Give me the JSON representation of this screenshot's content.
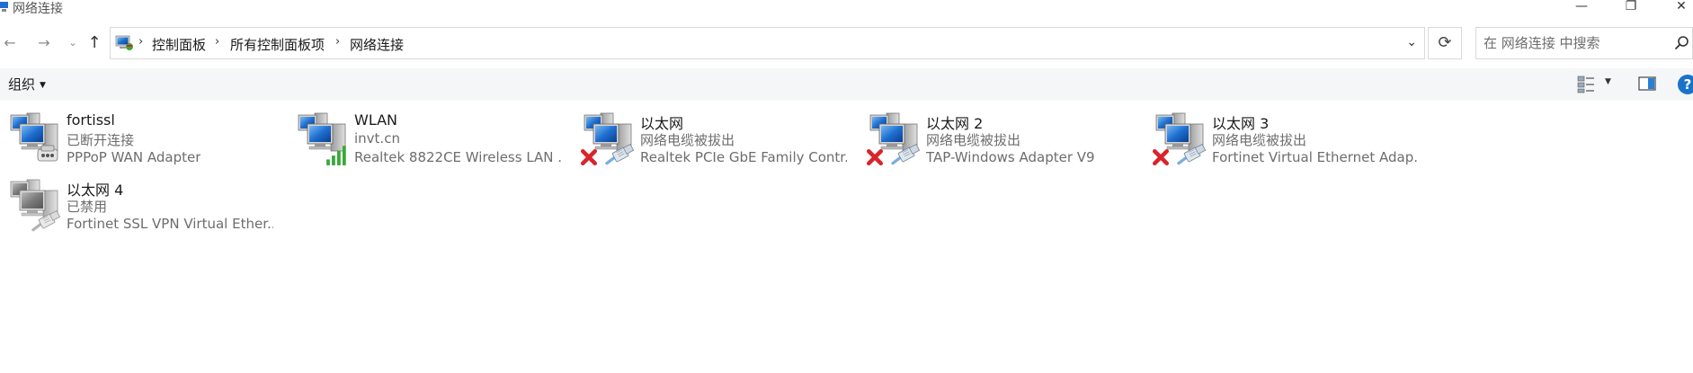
{
  "window": {
    "title": "网络连接"
  },
  "address_bar": {
    "breadcrumbs": [
      "控制面板",
      "所有控制面板项",
      "网络连接"
    ]
  },
  "search": {
    "placeholder": "在 网络连接 中搜索"
  },
  "toolbar": {
    "organize_label": "组织"
  },
  "connections": [
    {
      "name": "fortissl",
      "status": "已断开连接",
      "device": "PPPoP WAN Adapter",
      "icon": "pppoe-modem-icon",
      "badge": "none"
    },
    {
      "name": "WLAN",
      "status": "invt.cn",
      "device": "Realtek 8822CE Wireless LAN ...",
      "icon": "wifi-signal-icon",
      "badge": "signal"
    },
    {
      "name": "以太网",
      "status": "网络电缆被拔出",
      "device": "Realtek PCIe GbE Family Contr...",
      "icon": "ethernet-cable-icon",
      "badge": "red-x"
    },
    {
      "name": "以太网 2",
      "status": "网络电缆被拔出",
      "device": "TAP-Windows Adapter V9",
      "icon": "ethernet-cable-icon",
      "badge": "red-x"
    },
    {
      "name": "以太网 3",
      "status": "网络电缆被拔出",
      "device": "Fortinet Virtual Ethernet Adap...",
      "icon": "ethernet-cable-icon",
      "badge": "red-x"
    },
    {
      "name": "以太网 4",
      "status": "已禁用",
      "device": "Fortinet SSL VPN Virtual Ether...",
      "icon": "ethernet-cable-icon",
      "badge": "disabled"
    }
  ],
  "colors": {
    "accent": "#1a73c9",
    "error": "#d9232b",
    "signal": "#3aa83a",
    "toolbar_bg": "#f5f6f7"
  }
}
